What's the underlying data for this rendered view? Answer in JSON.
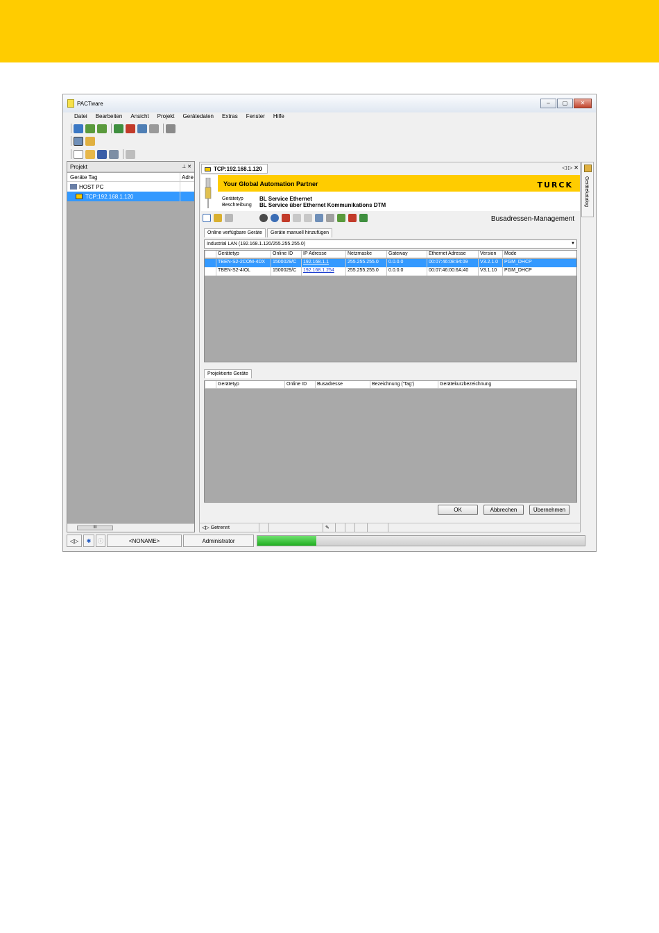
{
  "window": {
    "title": "PACTware"
  },
  "window_buttons": [
    "–",
    "▢",
    "✕"
  ],
  "menu": [
    "Datei",
    "Bearbeiten",
    "Ansicht",
    "Projekt",
    "Gerätedaten",
    "Extras",
    "Fenster",
    "Hilfe"
  ],
  "project_panel": {
    "title": "Projekt",
    "pin_close": "⊥ ✕",
    "columns": [
      "Geräte Tag",
      "Adre"
    ],
    "tree": [
      {
        "label": "HOST PC",
        "selected": false
      },
      {
        "label": "TCP:192.168.1.120",
        "selected": true
      }
    ],
    "scroll_thumb": "III"
  },
  "catalog_tab": "Gerätekatalog",
  "dtm": {
    "tab_label": "TCP:192.168.1.120",
    "tab_nav": "◁ ▷ ✕",
    "slogan": "Your Global Automation Partner",
    "logo": "TURCK",
    "device_type_label": "Gerätetyp",
    "device_type_value": "BL Service Ethernet",
    "description_label": "Beschreibung",
    "description_value": "BL Service über Ethernet Kommunikations DTM",
    "heading": "Busadressen-Management",
    "tabs": [
      "Online verfügbare Geräte",
      "Geräte manuell hinzufügen"
    ],
    "network_dropdown": "Industrial LAN (192.168.1.120/255.255.255.0)",
    "online_table": {
      "columns": [
        "Gerätetyp",
        "Online ID",
        "IP Adresse",
        "Netzmaske",
        "Gateway",
        "Ethernet Adresse",
        "Version",
        "Mode"
      ],
      "rows": [
        {
          "selected": true,
          "cells": [
            "TBEN-S2-2COM-4DX",
            "1500029/C",
            "192.168.1.1",
            "255.255.255.0",
            "0.0.0.0",
            "00:07:46:08:94:09",
            "V3.2.1.0",
            "PGM_DHCP"
          ]
        },
        {
          "selected": false,
          "cells": [
            "TBEN-S2-4IOL",
            "1500029/C",
            "192.168.1.254",
            "255.255.255.0",
            "0.0.0.0",
            "00:07:46:00:6A:40",
            "V3.1.10",
            "PGM_DHCP"
          ]
        }
      ]
    },
    "projected_tab": "Projektierte Geräte",
    "projected_table": {
      "columns": [
        "Gerätetyp",
        "Online ID",
        "Busadresse",
        "Bezeichnung ('Tag')",
        "Gerätekurzbezeichnung"
      ]
    },
    "buttons": {
      "ok": "OK",
      "cancel": "Abbrechen",
      "apply": "Übernehmen"
    },
    "status": "Getrennt"
  },
  "statusbar": {
    "project_name": "<NONAME>",
    "user": "Administrator",
    "progress": 0.18
  },
  "colors": {
    "brand_yellow": "#ffcc00",
    "selection": "#3399ff",
    "progress": "#1fae1f"
  }
}
